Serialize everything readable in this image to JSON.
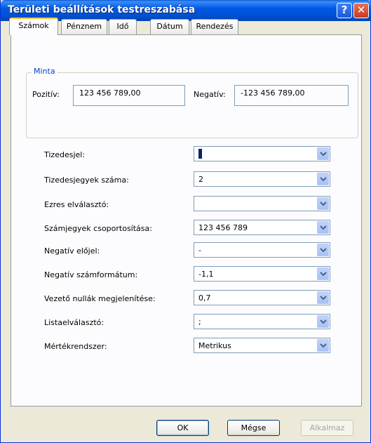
{
  "window": {
    "title": "Területi beállítások testreszabása",
    "help_label": "?",
    "close_label": "✕"
  },
  "tabs": [
    {
      "label": "Számok"
    },
    {
      "label": "Pénznem"
    },
    {
      "label": "Idő"
    },
    {
      "label": "Dátum"
    },
    {
      "label": "Rendezés"
    }
  ],
  "sample": {
    "group_label": "Minta",
    "positive_label": "Pozitív:",
    "positive_value": "123 456 789,00",
    "negative_label": "Negatív:",
    "negative_value": "-123 456 789,00"
  },
  "fields": [
    {
      "label": "Tizedesjel:",
      "value": ""
    },
    {
      "label": "Tizedesjegyek száma:",
      "value": "2"
    },
    {
      "label": "Ezres elválasztó:",
      "value": ""
    },
    {
      "label": "Számjegyek csoportosítása:",
      "value": "123 456 789"
    },
    {
      "label": "Negatív előjel:",
      "value": "-"
    },
    {
      "label": "Negatív számformátum:",
      "value": "-1,1"
    },
    {
      "label": "Vezető nullák megjelenítése:",
      "value": "0,7"
    },
    {
      "label": "Listaelválasztó:",
      "value": ";"
    },
    {
      "label": "Mértékrendszer:",
      "value": "Metrikus"
    }
  ],
  "buttons": {
    "ok": "OK",
    "cancel": "Mégse",
    "apply": "Alkalmaz"
  },
  "icons": {
    "dropdown": "chevron-down-icon"
  },
  "colors": {
    "title_bar": "#0058e6",
    "group_label": "#0046d5",
    "tab_highlight": "#ffc83c"
  }
}
